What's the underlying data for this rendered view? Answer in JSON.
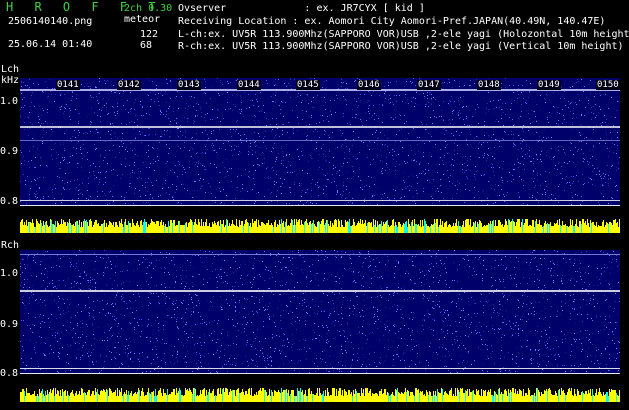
{
  "header": {
    "app_title": "H R O F F T",
    "version": "2ch 0.30",
    "filename": "2506140140.png",
    "datetime": "25.06.14 01:40",
    "meteor_label": "meteor",
    "l_count": "122",
    "r_count": "68",
    "info_lines": [
      "Ovserver             : ex. JR7CYX [ kid ]",
      "Receiving Location : ex. Aomori City Aomori-Pref.JAPAN(40.49N, 140.47E)",
      "L-ch:ex. UV5R 113.900Mhz(SAPPORO VOR)USB ,2-ele yagi (Holozontal 10m height)",
      "R-ch:ex. UV5R 113.900Mhz(SAPPORO VOR)USB ,2-ele yagi (Vertical 10m height)"
    ]
  },
  "left_channel": {
    "label": "Lch",
    "unit": "kHz",
    "y_ticks": [
      "1.0",
      "0.9",
      "0.8"
    ],
    "time_ticks": [
      "0141",
      "0142",
      "0143",
      "0144",
      "0145",
      "0146",
      "0147",
      "0148",
      "0149",
      "0150"
    ]
  },
  "right_channel": {
    "label": "Rch",
    "y_ticks": [
      "1.0",
      "0.9",
      "0.8"
    ]
  },
  "colors": {
    "background": "#000000",
    "spectrogram_bg": "#00006a",
    "level_bar": "#ffff00",
    "level_bar_base": "#00ffff",
    "title_green": "#3fd23f"
  }
}
